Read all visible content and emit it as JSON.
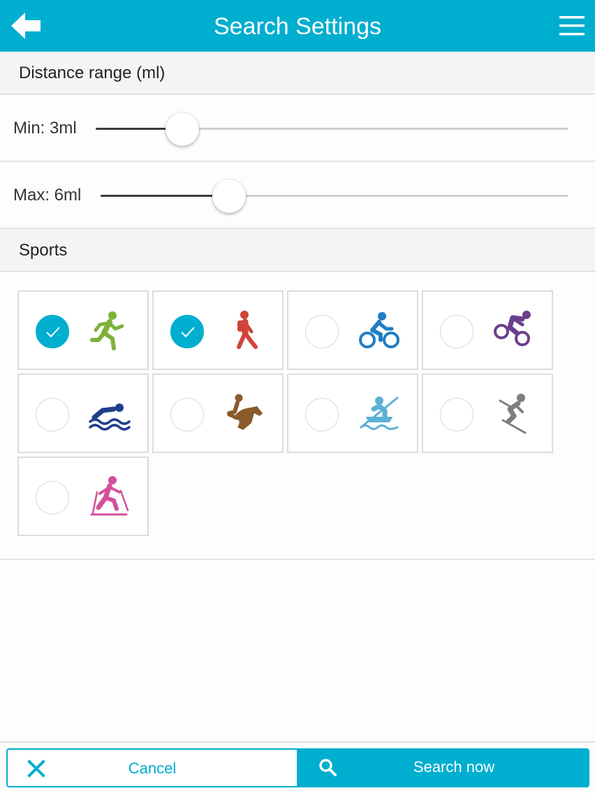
{
  "header": {
    "title": "Search Settings",
    "back_icon": "arrow-left-icon",
    "menu_icon": "hamburger-menu-icon",
    "bg_color": "#00aecf"
  },
  "distance": {
    "section_title": "Distance range (ml)",
    "min": {
      "label": "Min: 3ml",
      "value": 3
    },
    "max": {
      "label": "Max: 6ml",
      "value": 6
    }
  },
  "sports": {
    "section_title": "Sports",
    "items": [
      {
        "name": "running",
        "icon": "running-icon",
        "color": "#7db23a",
        "selected": true
      },
      {
        "name": "walking",
        "icon": "hiking-icon",
        "color": "#d0433a",
        "selected": true
      },
      {
        "name": "cycling",
        "icon": "cycling-icon",
        "color": "#1f7ec4",
        "selected": false
      },
      {
        "name": "mountain-biking",
        "icon": "mountain-bike-icon",
        "color": "#6b3f8c",
        "selected": false
      },
      {
        "name": "swimming",
        "icon": "swimming-icon",
        "color": "#1f3f8c",
        "selected": false
      },
      {
        "name": "horse-riding",
        "icon": "horse-riding-icon",
        "color": "#8a5a2b",
        "selected": false
      },
      {
        "name": "kayaking",
        "icon": "kayaking-icon",
        "color": "#5bb0d6",
        "selected": false
      },
      {
        "name": "skiing",
        "icon": "skiing-icon",
        "color": "#7f7f7f",
        "selected": false
      },
      {
        "name": "cross-country-skiing",
        "icon": "cross-country-skiing-icon",
        "color": "#d44f9a",
        "selected": false
      }
    ]
  },
  "footer": {
    "cancel_label": "Cancel",
    "cancel_icon": "close-icon",
    "search_label": "Search now",
    "search_icon": "search-icon"
  }
}
